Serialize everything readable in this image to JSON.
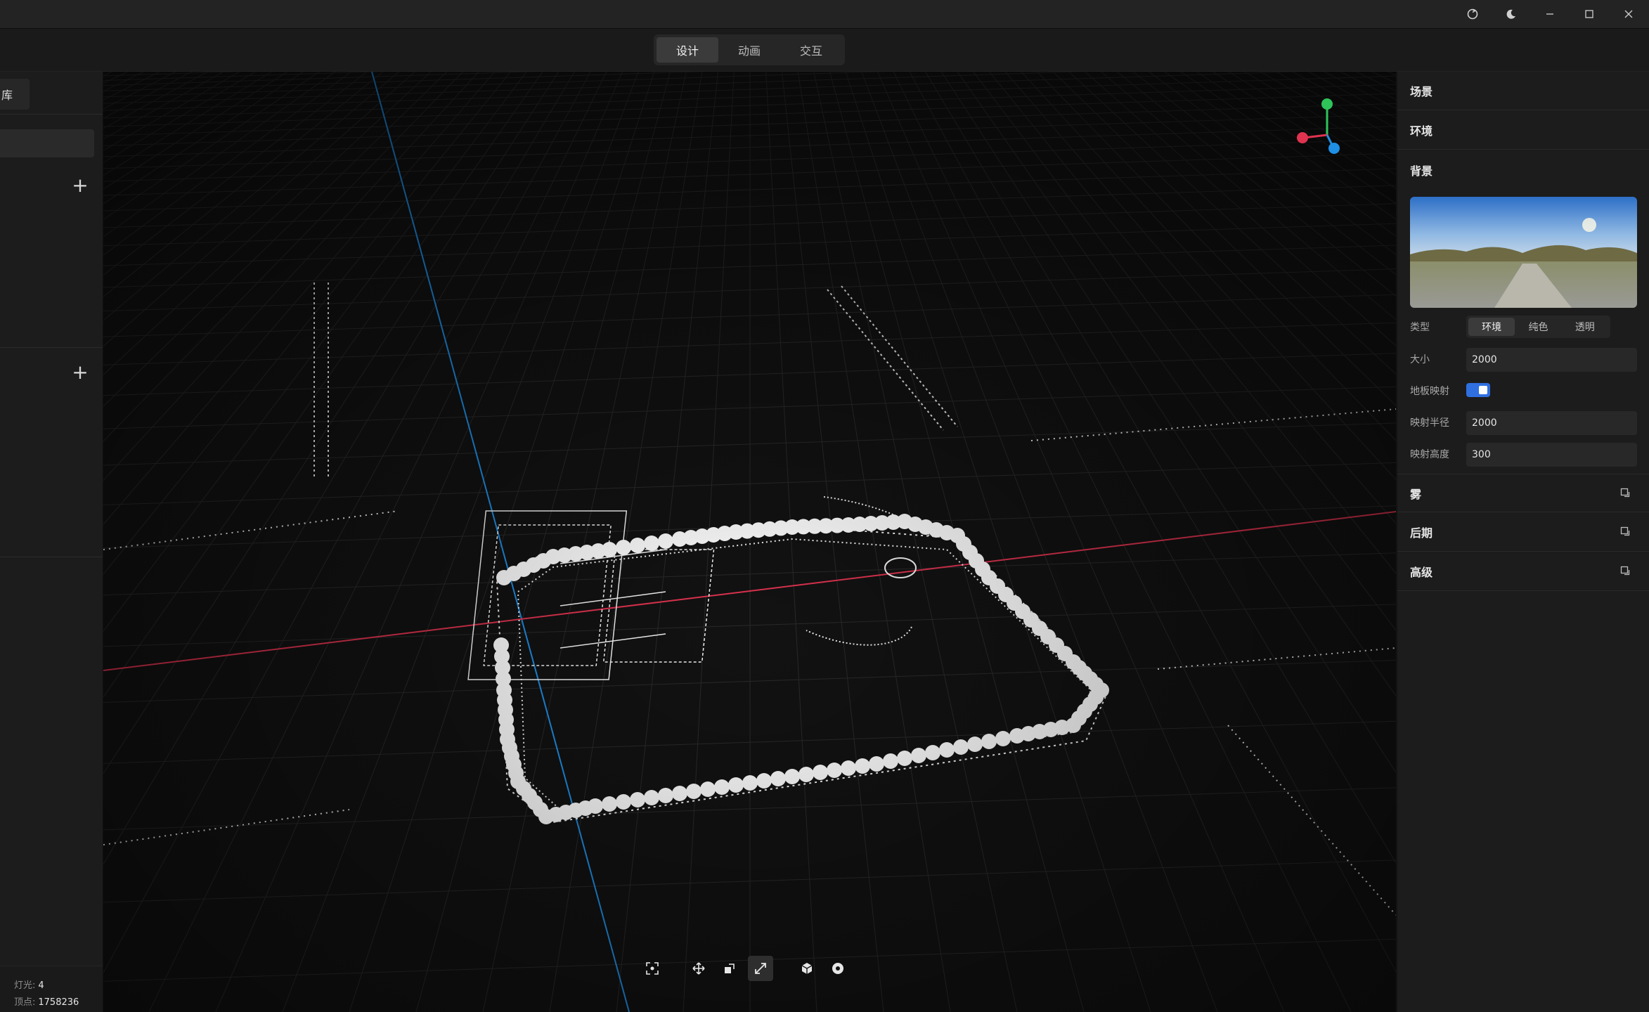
{
  "titlebar": {
    "icons": [
      "refresh-icon",
      "moon-icon",
      "minimize-icon",
      "maximize-icon",
      "close-icon"
    ]
  },
  "mode_tabs": [
    {
      "label": "设计",
      "active": true
    },
    {
      "label": "动画",
      "active": false
    },
    {
      "label": "交互",
      "active": false
    }
  ],
  "left_panel": {
    "tab_label": "库",
    "stats": {
      "lights_label": "灯光:",
      "lights_value": "4",
      "vertices_label": "顶点:",
      "vertices_value": "1758236"
    }
  },
  "viewport": {
    "axis_colors": {
      "x": "#e0334f",
      "y": "#2ec45a",
      "z": "#1f8fe6"
    },
    "grid_color": "#2a2a2a"
  },
  "bottom_tools": [
    "focus-icon",
    "move-icon",
    "rotate-icon",
    "scale-icon",
    "cube-icon",
    "settings-icon"
  ],
  "right_panel": {
    "scene": "场景",
    "environment": "环境",
    "background": "背景",
    "type_label": "类型",
    "type_options": [
      "环境",
      "纯色",
      "透明"
    ],
    "size_label": "大小",
    "size_value": "2000",
    "ground_label": "地板映射",
    "ground_on": true,
    "radius_label": "映射半径",
    "radius_value": "2000",
    "height_label": "映射高度",
    "height_value": "300",
    "fog": "雾",
    "post": "后期",
    "advanced": "高级"
  },
  "accent_color": "#2f6fe0"
}
